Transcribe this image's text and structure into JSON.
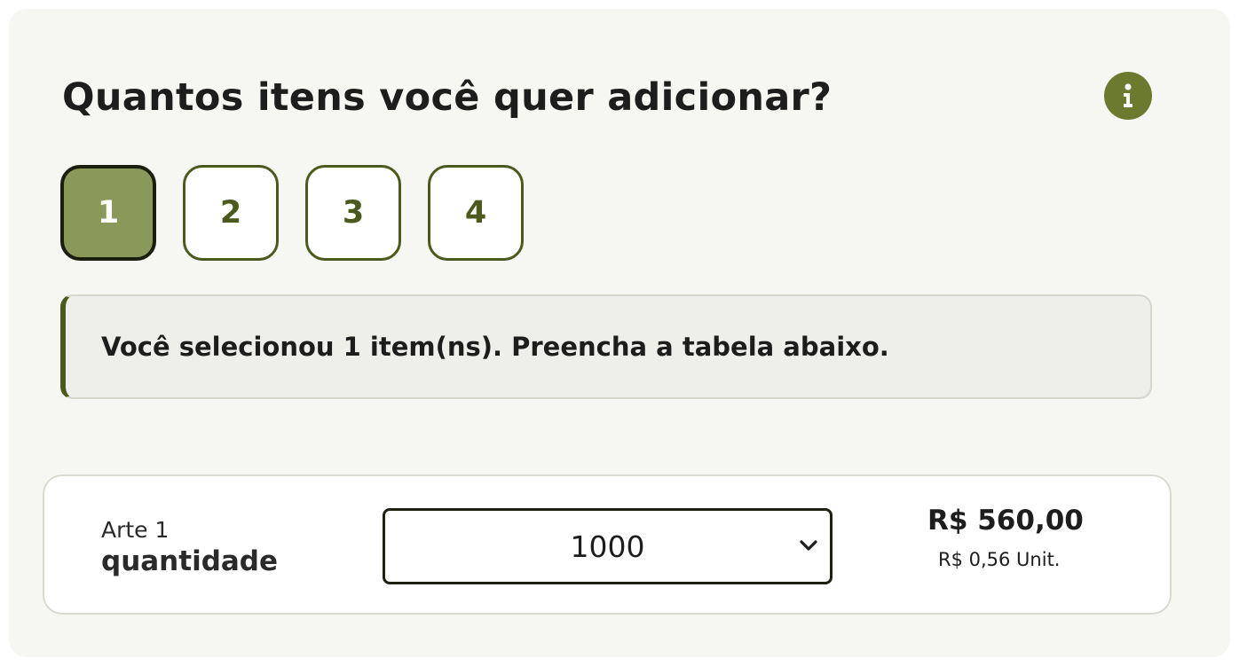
{
  "header": {
    "title": "Quantos itens você quer adicionar?",
    "info_icon": "info-icon"
  },
  "quantity_options": {
    "selected": "1",
    "items": [
      {
        "label": "1"
      },
      {
        "label": "2"
      },
      {
        "label": "3"
      },
      {
        "label": "4"
      }
    ]
  },
  "alert": {
    "text": "Você selecionou 1 item(ns). Preencha a tabela abaixo."
  },
  "item": {
    "name": "Arte 1",
    "field_label": "quantidade",
    "quantity_value": "1000",
    "total_price": "R$ 560,00",
    "unit_price": "R$ 0,56 Unit."
  },
  "colors": {
    "accent": "#6b7a2e",
    "active_button": "#8a9859",
    "border_dark": "#4b5a1c",
    "card_background": "#f6f6f3"
  }
}
